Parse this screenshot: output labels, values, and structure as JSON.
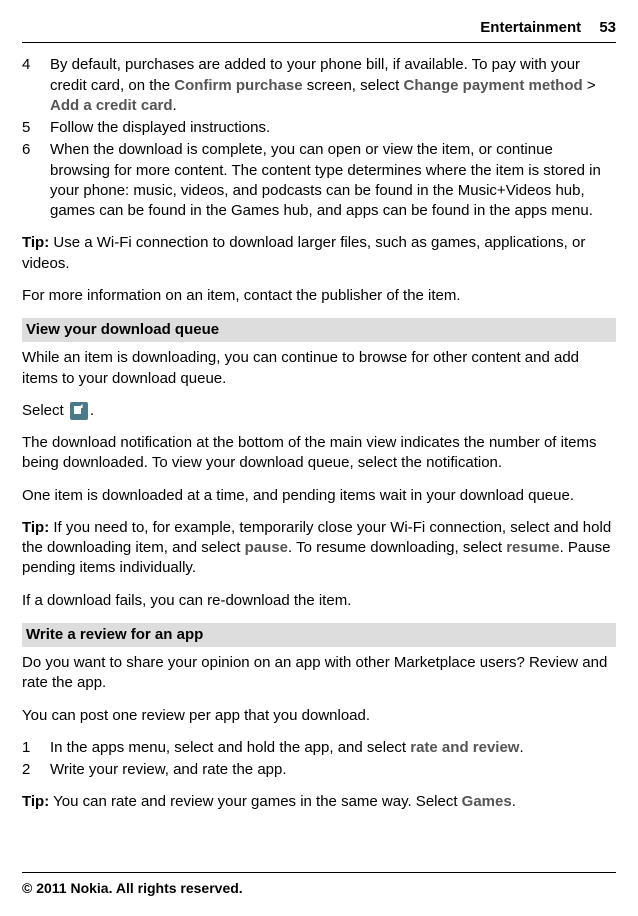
{
  "header": {
    "section": "Entertainment",
    "page": "53"
  },
  "list1": [
    {
      "num": "4",
      "prefix": "By default, purchases are added to your phone bill, if available. To pay with your credit card, on the ",
      "b1": "Confirm purchase",
      "mid1": " screen, select ",
      "b2": "Change payment method",
      "mid2": " > ",
      "b3": "Add a credit card",
      "suffix": "."
    },
    {
      "num": "5",
      "text": "Follow the displayed instructions."
    },
    {
      "num": "6",
      "text": "When the download is complete, you can open or view the item, or continue browsing for more content. The content type determines where the item is stored in your phone: music, videos, and podcasts can be found in the Music+Videos hub, games can be found in the Games hub, and apps can be found in the apps menu."
    }
  ],
  "tip1": {
    "label": "Tip:",
    "text": " Use a Wi-Fi connection to download larger files, such as games, applications, or videos."
  },
  "para1": "For more information on an item, contact the publisher of the item.",
  "section1_head": "View your download queue",
  "section1_p1": "While an item is downloading, you can continue to browse for other content and add items to your download queue.",
  "section1_select_prefix": "Select ",
  "section1_select_suffix": ".",
  "section1_p2": "The download notification at the bottom of the main view indicates the number of items being downloaded. To view your download queue, select the notification.",
  "section1_p3": "One item is downloaded at a time, and pending items wait in your download queue.",
  "tip2": {
    "label": "Tip:",
    "p1": " If you need to, for example, temporarily close your Wi-Fi connection, select and hold the downloading item, and select ",
    "b1": "pause",
    "p2": ". To resume downloading, select ",
    "b2": "resume",
    "p3": ". Pause pending items individually."
  },
  "section1_p4": "If a download fails, you can re-download the item.",
  "section2_head": "Write a review for an app",
  "section2_p1": "Do you want to share your opinion on an app with other Marketplace users? Review and rate the app.",
  "section2_p2": "You can post one review per app that you download.",
  "list2": [
    {
      "num": "1",
      "prefix": "In the apps menu, select and hold the app, and select ",
      "b1": "rate and review",
      "suffix": "."
    },
    {
      "num": "2",
      "text": "Write your review, and rate the app."
    }
  ],
  "tip3": {
    "label": "Tip:",
    "p1": " You can rate and review your games in the same way. Select ",
    "b1": "Games",
    "p2": "."
  },
  "footer": "© 2011 Nokia. All rights reserved."
}
